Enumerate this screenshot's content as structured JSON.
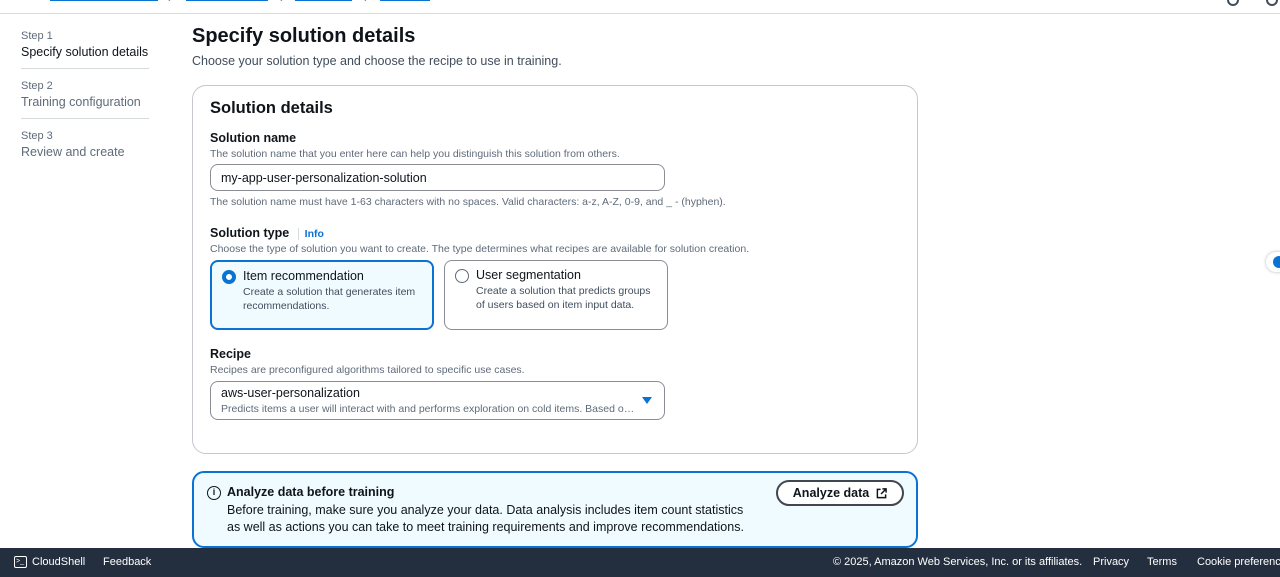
{
  "steps": [
    {
      "num": "Step 1",
      "label": "Specify solution details"
    },
    {
      "num": "Step 2",
      "label": "Training configuration"
    },
    {
      "num": "Step 3",
      "label": "Review and create"
    }
  ],
  "header": {
    "title": "Specify solution details",
    "description": "Choose your solution type and choose the recipe to use in training."
  },
  "solution_details": {
    "title": "Solution details",
    "name_label": "Solution name",
    "name_desc": "The solution name that you enter here can help you distinguish this solution from others.",
    "name_value": "my-app-user-personalization-solution",
    "name_constraint": "The solution name must have 1-63 characters with no spaces. Valid characters: a-z, A-Z, 0-9, and _ - (hyphen).",
    "type_label": "Solution type",
    "info_link": "Info",
    "type_desc": "Choose the type of solution you want to create. The type determines what recipes are available for solution creation.",
    "types": [
      {
        "title": "Item recommendation",
        "desc": "Create a solution that generates item recommendations.",
        "selected": true
      },
      {
        "title": "User segmentation",
        "desc": "Create a solution that predicts groups of users based on item input data.",
        "selected": false
      }
    ],
    "recipe_label": "Recipe",
    "recipe_desc": "Recipes are preconfigured algorithms tailored to specific use cases.",
    "recipe_value": "aws-user-personalization",
    "recipe_value_desc": "Predicts items a user will interact with and performs exploration on cold items. Based on the user interaction history, it predicts items for users."
  },
  "alert": {
    "title": "Analyze data before training",
    "body": "Before training, make sure you analyze your data. Data analysis includes item count statistics as well as actions you can take to meet training requirements and improve recommendations.",
    "button": "Analyze data"
  },
  "footer": {
    "cloudshell": "CloudShell",
    "feedback": "Feedback",
    "copyright": "© 2025, Amazon Web Services, Inc. or its affiliates.",
    "privacy": "Privacy",
    "terms": "Terms",
    "cookies": "Cookie preferences"
  },
  "colors": {
    "accent": "#0972d3",
    "footer_bg": "#232f3e",
    "selected_tile_bg": "#f0fbff"
  }
}
